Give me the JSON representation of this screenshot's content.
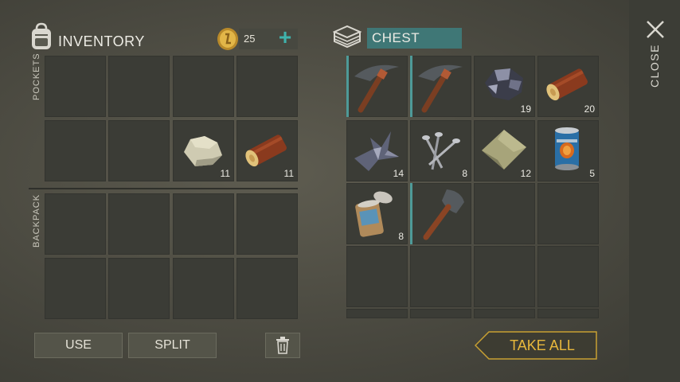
{
  "inventory": {
    "title": "INVENTORY",
    "coins": "25",
    "add_label": "+",
    "pockets_label": "POCKETS",
    "backpack_label": "BACKPACK",
    "pockets": [
      {
        "item": "",
        "count": ""
      },
      {
        "item": "",
        "count": ""
      },
      {
        "item": "",
        "count": ""
      },
      {
        "item": "",
        "count": ""
      },
      {
        "item": "",
        "count": ""
      },
      {
        "item": "",
        "count": ""
      },
      {
        "item": "stone-icon",
        "count": "11"
      },
      {
        "item": "log-icon",
        "count": "11"
      }
    ],
    "buttons": {
      "use": "USE",
      "split": "SPLIT"
    }
  },
  "chest": {
    "title": "CHEST",
    "slots": [
      {
        "item": "pickaxe-icon",
        "count": ""
      },
      {
        "item": "pickaxe-icon",
        "count": ""
      },
      {
        "item": "iron-ore-icon",
        "count": "19"
      },
      {
        "item": "log-icon",
        "count": "20"
      },
      {
        "item": "scrap-metal-icon",
        "count": "14"
      },
      {
        "item": "nails-icon",
        "count": "8"
      },
      {
        "item": "cloth-icon",
        "count": "12"
      },
      {
        "item": "beans-can-icon",
        "count": "5"
      },
      {
        "item": "open-can-icon",
        "count": "8"
      },
      {
        "item": "shovel-icon",
        "count": ""
      }
    ],
    "take_all": "TAKE ALL"
  },
  "sidebar": {
    "close_label": "CLOSE"
  },
  "colors": {
    "accent": "#4e9a98",
    "take_all": "#c8a032",
    "slot": "#3b3c36"
  }
}
